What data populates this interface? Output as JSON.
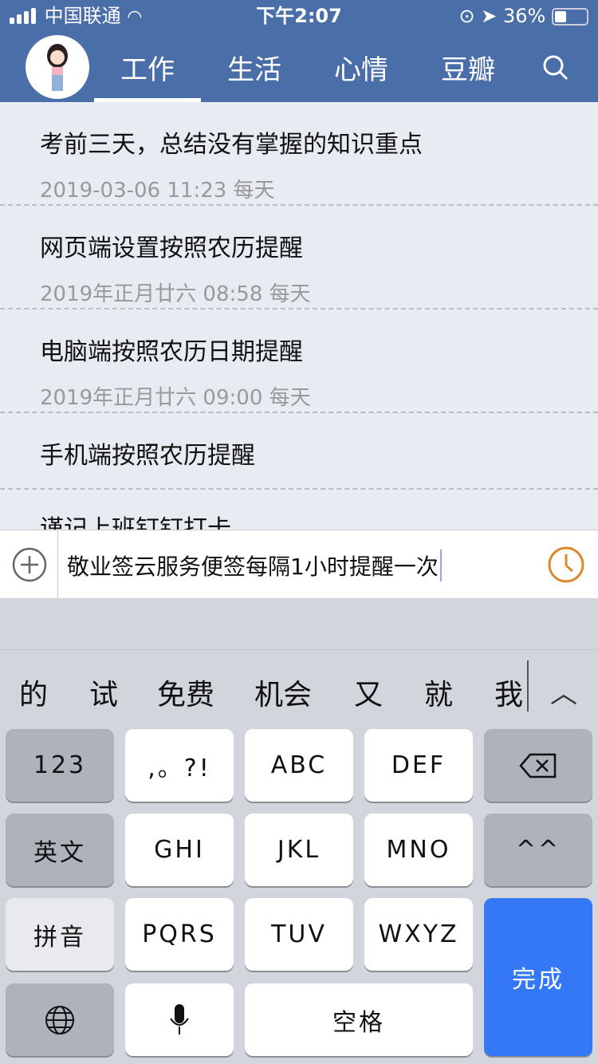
{
  "status": {
    "carrier": "中国联通",
    "time": "下午2:07",
    "battery": "36%"
  },
  "tabs": [
    {
      "label": "工作",
      "active": true
    },
    {
      "label": "生活"
    },
    {
      "label": "心情"
    },
    {
      "label": "豆瓣"
    }
  ],
  "items": [
    {
      "title": "考前三天，总结没有掌握的知识重点",
      "date": "2019-03-06 11:23 每天"
    },
    {
      "title": "网页端设置按照农历提醒",
      "date": "2019年正月廿六 08:58 每天"
    },
    {
      "title": "电脑端按照农历日期提醒",
      "date": "2019年正月廿六 09:00 每天"
    },
    {
      "title": "手机端按照农历提醒",
      "date": ""
    },
    {
      "title": "谨记上班钉钉打卡",
      "date": ""
    }
  ],
  "input": {
    "value": "敬业签云服务便签每隔1小时提醒一次"
  },
  "colors": {
    "header": "#4a6ea8",
    "clock": "#d98a2b",
    "done": "#3478f6"
  },
  "candidates": [
    "的",
    "试",
    "免费",
    "机会",
    "又",
    "就",
    "我"
  ],
  "keys": {
    "r1": [
      "123",
      ",。?!",
      "ABC",
      "DEF"
    ],
    "r2": [
      "英文",
      "GHI",
      "JKL",
      "MNO",
      "^^"
    ],
    "r3": [
      "拼音",
      "PQRS",
      "TUV",
      "WXYZ"
    ],
    "space": "空格",
    "done": "完成"
  }
}
